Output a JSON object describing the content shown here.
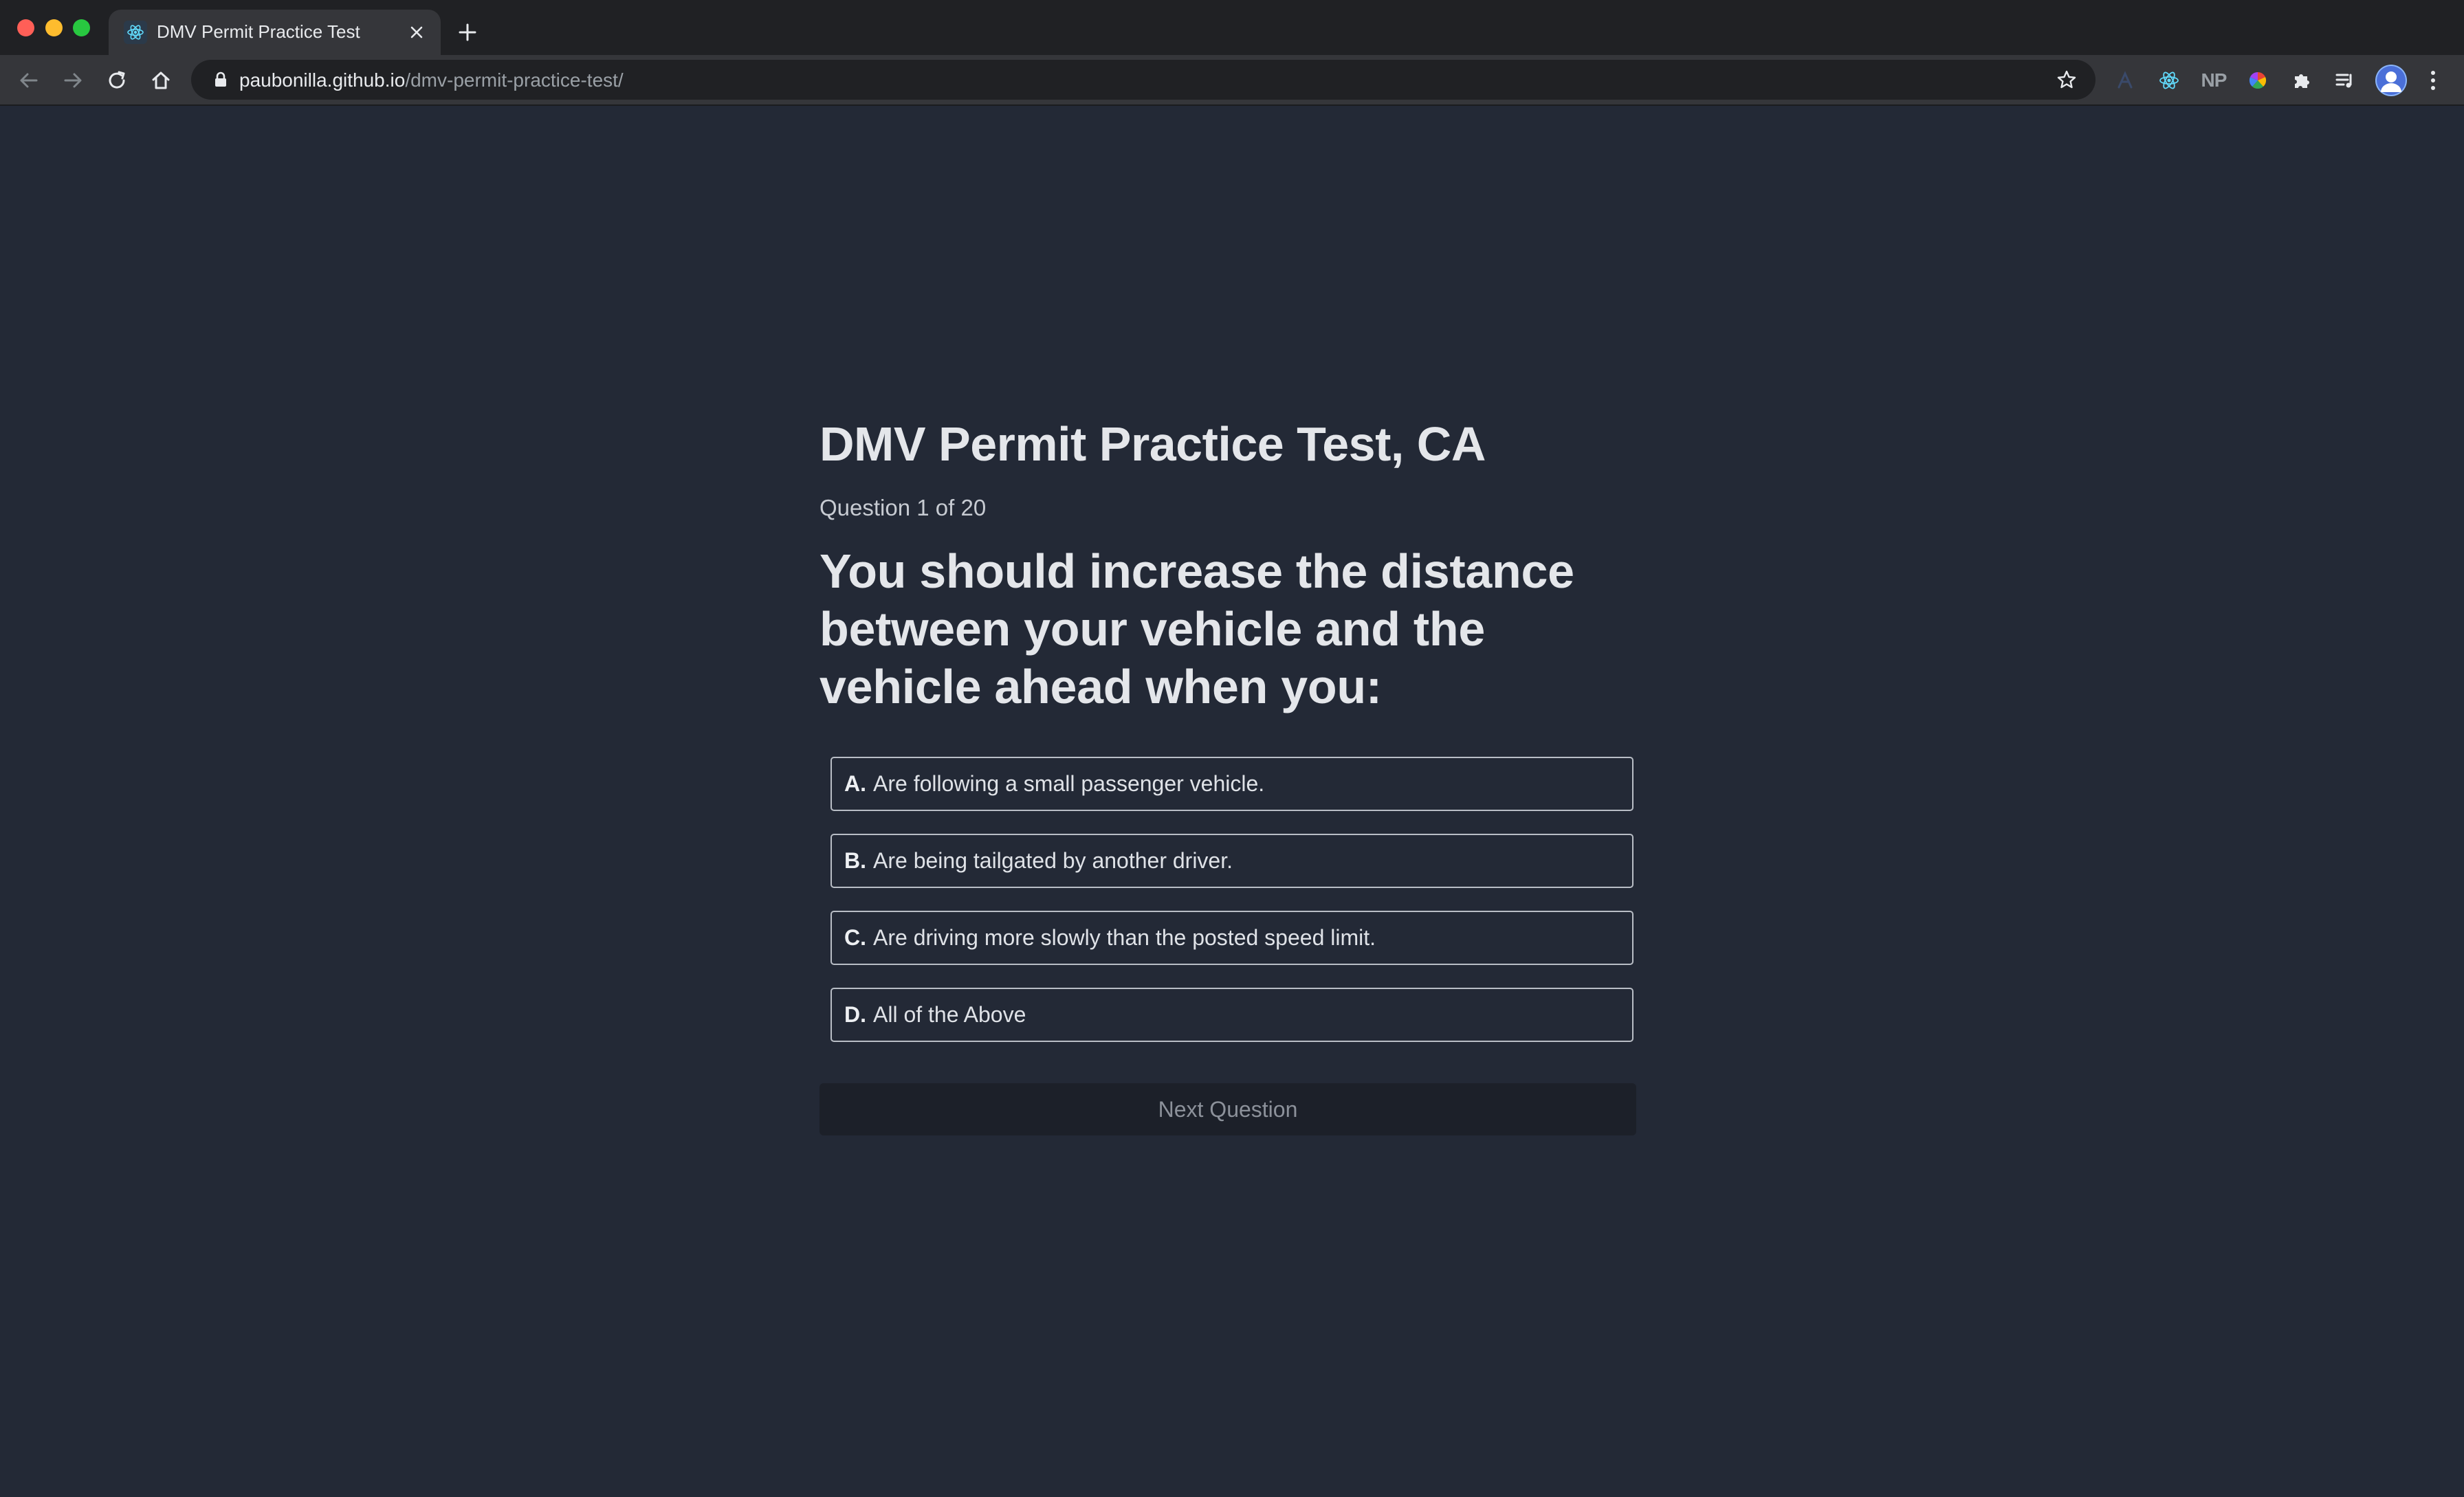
{
  "browser": {
    "tab_title": "DMV Permit Practice Test",
    "url_host": "paubonilla.github.io",
    "url_path": "/dmv-permit-practice-test/",
    "extensions": {
      "np_label": "NP"
    }
  },
  "page": {
    "title": "DMV Permit Practice Test, CA",
    "counter": "Question 1 of 20",
    "question": "You should increase the distance between your vehicle and the vehicle ahead when you:",
    "answers": [
      {
        "letter": "A.",
        "text": "Are following a small passenger vehicle."
      },
      {
        "letter": "B.",
        "text": "Are being tailgated by another driver."
      },
      {
        "letter": "C.",
        "text": "Are driving more slowly than the posted speed limit."
      },
      {
        "letter": "D.",
        "text": "All of the Above"
      }
    ],
    "next_label": "Next Question"
  },
  "colors": {
    "page_bg": "#232936",
    "chrome_dark": "#202124",
    "chrome_toolbar": "#35363a",
    "answer_border": "#b9bec6",
    "button_bg": "#1c2029"
  }
}
